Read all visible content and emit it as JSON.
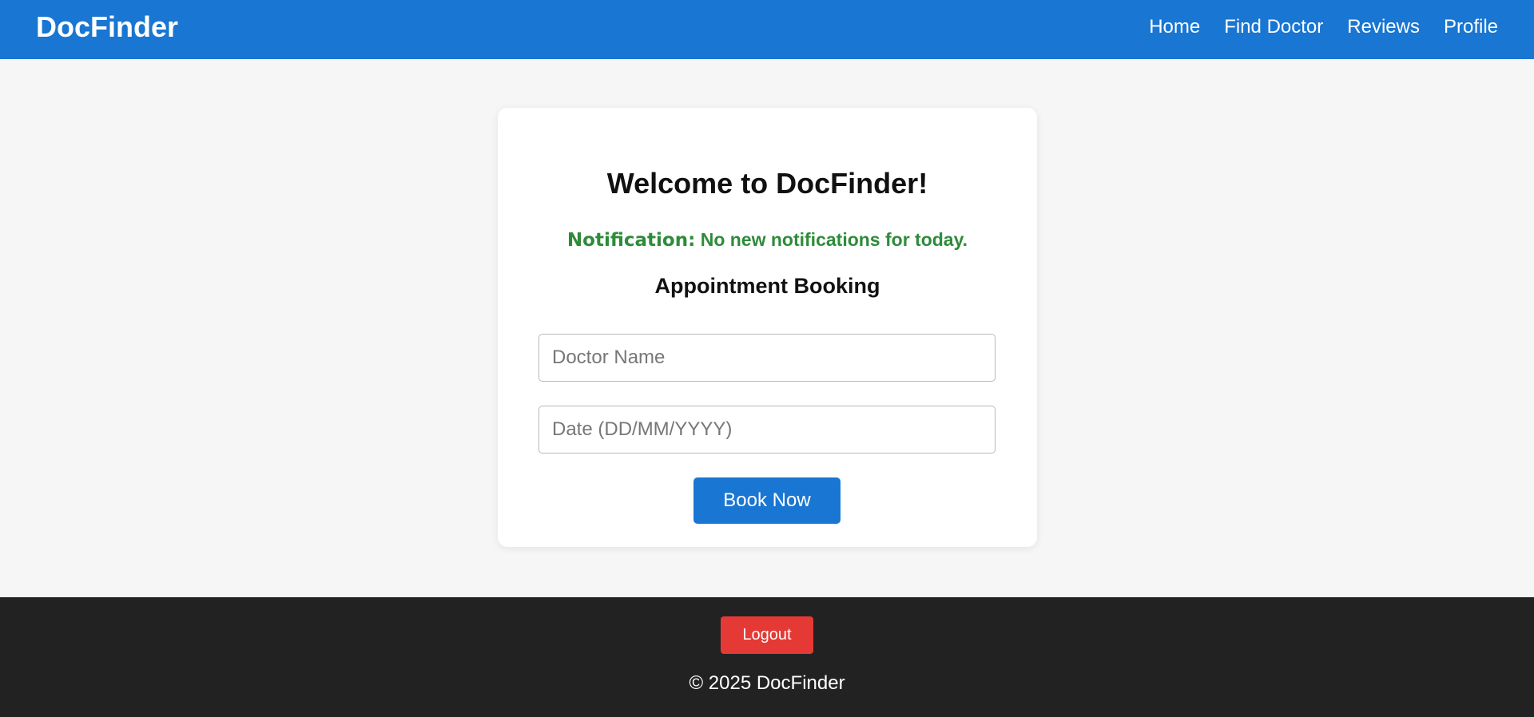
{
  "header": {
    "brand": "DocFinder",
    "nav": [
      {
        "label": "Home"
      },
      {
        "label": "Find Doctor"
      },
      {
        "label": "Reviews"
      },
      {
        "label": "Profile"
      }
    ]
  },
  "card": {
    "welcome": "Welcome to DocFinder!",
    "notification_label": "Notification:",
    "notification_text": "No new notifications for today.",
    "booking_title": "Appointment Booking",
    "doctor_name_placeholder": "Doctor Name",
    "doctor_name_value": "",
    "date_placeholder": "Date (DD/MM/YYYY)",
    "date_value": "",
    "book_label": "Book Now"
  },
  "footer": {
    "logout_label": "Logout",
    "copyright": "© 2025 DocFinder"
  },
  "colors": {
    "primary": "#1976d2",
    "notification": "#2e8b3a",
    "logout": "#e53935",
    "footer_bg": "#222222",
    "page_bg": "#f6f6f6"
  }
}
